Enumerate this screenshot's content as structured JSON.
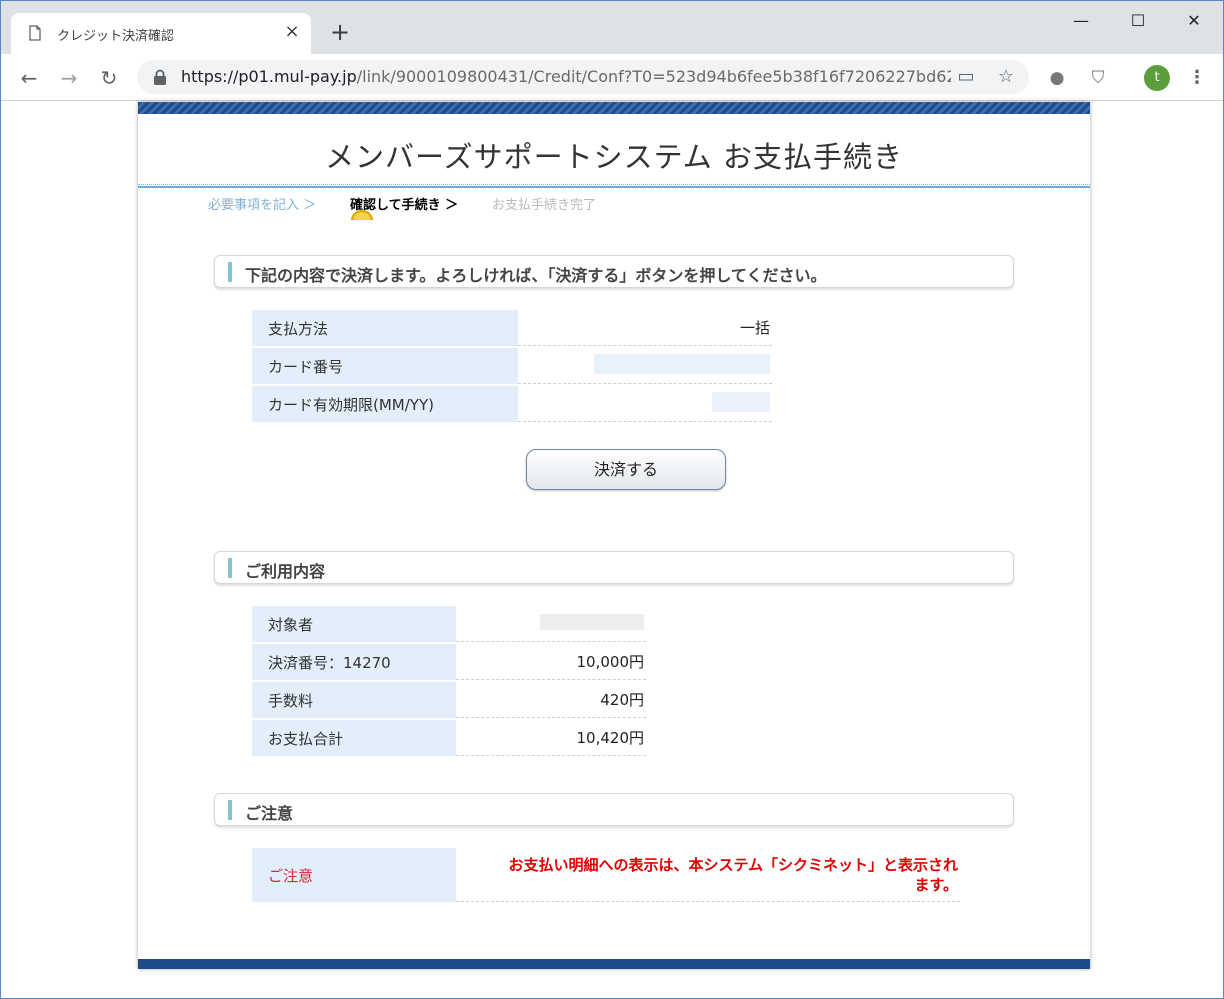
{
  "browser": {
    "tab_title": "クレジット決済確認",
    "tab_close_icon": "×",
    "new_tab_icon": "+",
    "url_host": "https://p01.mul-pay.jp",
    "url_path": "/link/9000109800431/Credit/Conf?T0=523d94b6fee5b38f16f7206227bd62...",
    "profile_initial": "t"
  },
  "page": {
    "title": "メンバーズサポートシステム お支払手続き",
    "steps": [
      "必要事項を記入 ＞",
      "確認して手続き ＞",
      "お支払手続き完了"
    ]
  },
  "confirm": {
    "heading": "下記の内容で決済します。よろしければ、「決済する」ボタンを押してください。",
    "rows": [
      {
        "label": "支払方法",
        "value": "一括"
      },
      {
        "label": "カード番号",
        "value": ""
      },
      {
        "label": "カード有効期限(MM/YY)",
        "value": ""
      }
    ],
    "button_label": "決済する"
  },
  "usage": {
    "heading": "ご利用内容",
    "rows": [
      {
        "label": "対象者",
        "value": ""
      },
      {
        "label": "決済番号：14270",
        "value": "10,000円"
      },
      {
        "label": "手数料",
        "value": "420円"
      },
      {
        "label": "お支払合計",
        "value": "10,420円"
      }
    ]
  },
  "notice": {
    "heading": "ご注意",
    "label": "ご注意",
    "text_line1": "お支払い明細への表示は、本システム「シクミネット」と表示され",
    "text_line2": "ます。"
  },
  "colors": {
    "accent_blue": "#1f4a8c",
    "label_bg": "#e3eefb",
    "notice_red": "#e00000"
  }
}
